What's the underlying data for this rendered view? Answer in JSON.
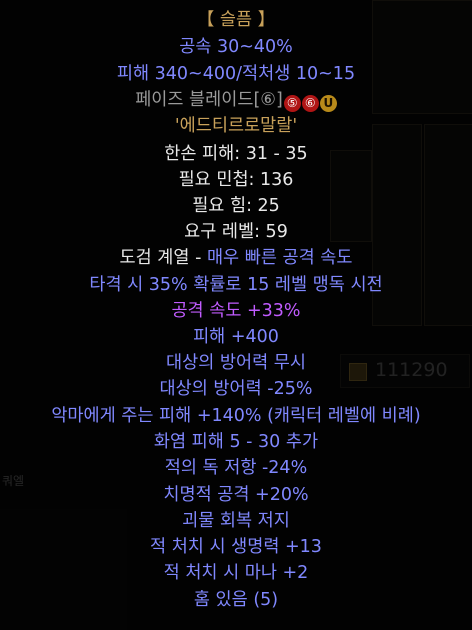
{
  "tooltip": {
    "header": "【 슬픔 】",
    "runeword_lines": [
      "공속 30~40%",
      "피해 340~400/적처생 10~15"
    ],
    "base_name": "페이즈 블레이드",
    "base_tags": [
      "⑥",
      "⑤",
      "⑥",
      "U"
    ],
    "rune_order": "'에드티르로말랄'",
    "stats": [
      {
        "text": "한손 피해: 31 - 35",
        "color": "white"
      },
      {
        "text": "필요 민첩: 136",
        "color": "white"
      },
      {
        "text": "필요 힘: 25",
        "color": "white"
      },
      {
        "text": "요구 레벨: 59",
        "color": "white"
      }
    ],
    "class_line": {
      "prefix": "도검 계열 - ",
      "suffix": "매우 빠른 공격 속도"
    },
    "mods": [
      {
        "text": "타격 시 35% 확률로 15 레벨 맹독 시전",
        "color": "blue"
      },
      {
        "text": "공격 속도 +33%",
        "color": "purple"
      },
      {
        "text": "피해 +400",
        "color": "blue"
      },
      {
        "text": "대상의 방어력 무시",
        "color": "blue"
      },
      {
        "text": "대상의 방어력 -25%",
        "color": "blue"
      },
      {
        "text": "악마에게 주는 피해 +140% (캐릭터 레벨에 비례)",
        "color": "blue"
      },
      {
        "text": "화염 피해 5 - 30 추가",
        "color": "blue"
      },
      {
        "text": "적의 독 저항 -24%",
        "color": "blue"
      },
      {
        "text": "치명적 공격 +20%",
        "color": "blue"
      },
      {
        "text": "괴물 회복 저지",
        "color": "blue"
      },
      {
        "text": "적 처치 시 생명력 +13",
        "color": "blue"
      },
      {
        "text": "적 처치 시 마나 +2",
        "color": "blue"
      },
      {
        "text": "홈 있음 (5)",
        "color": "blue"
      }
    ]
  },
  "background": {
    "gold_amount": "111290",
    "left_label": "쿼엘"
  },
  "colors": {
    "header": "#c8a15a",
    "magic_blue": "#8088ff",
    "white": "#e8e8e8",
    "gray": "#9a9a9a",
    "purple": "#c15cff",
    "socket_red": "#b01515"
  }
}
